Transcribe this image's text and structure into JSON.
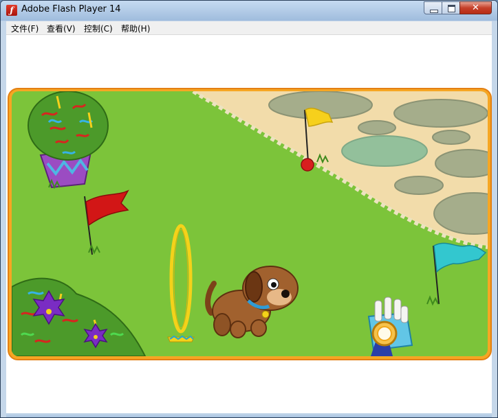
{
  "window": {
    "title": "Adobe Flash Player 14",
    "icon": "flash-player-icon",
    "controls": [
      "minimize-icon",
      "maximize-icon",
      "close-icon"
    ]
  },
  "menu": {
    "items": [
      "文件(F)",
      "查看(V)",
      "控制(C)",
      "帮助(H)"
    ]
  },
  "game": {
    "scene": "puppy agility course",
    "colors": {
      "frame": "#f08a1c",
      "grass": "#7cc43a",
      "path": "#f0d9a8",
      "stones": "#a3ac8a",
      "puppy": "#9c5a2c",
      "collar": "#2f9bd6"
    },
    "objects": [
      "flower-pot",
      "red-flag",
      "yellow-flag",
      "blue-flag",
      "hoop",
      "puppy",
      "bush",
      "ribbon-basket"
    ]
  }
}
